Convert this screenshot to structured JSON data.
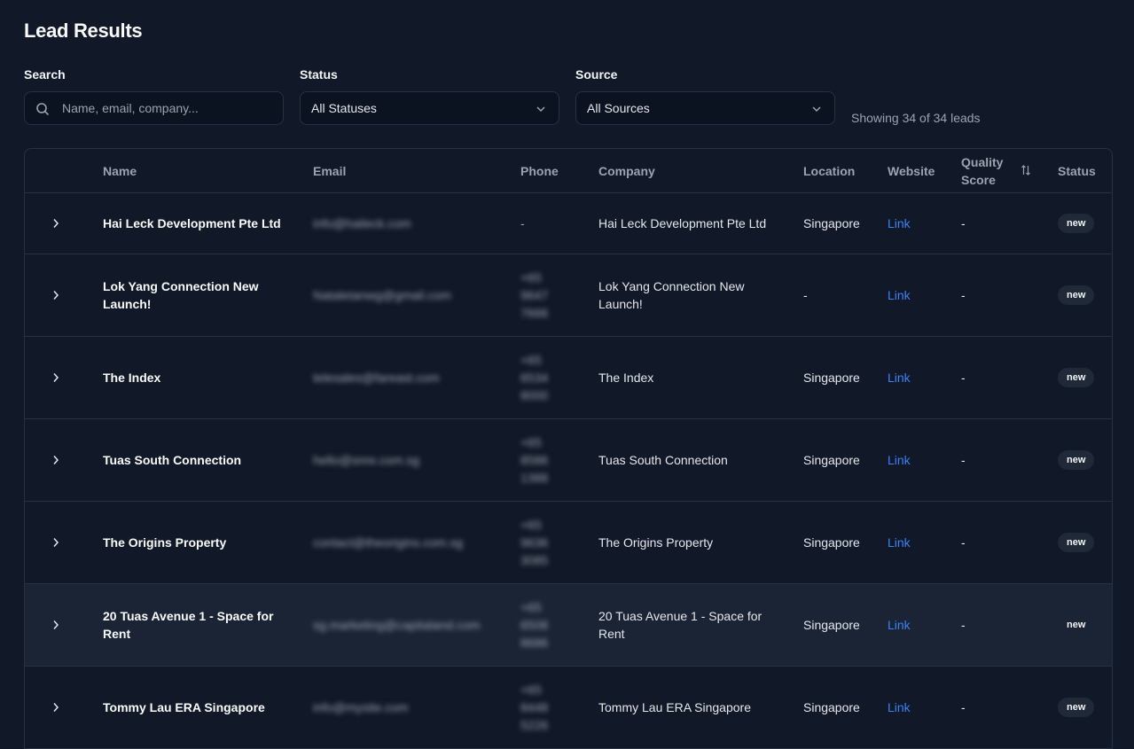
{
  "page": {
    "title": "Lead Results",
    "showing": "Showing 34 of 34 leads"
  },
  "filters": {
    "search": {
      "label": "Search",
      "placeholder": "Name, email, company..."
    },
    "status": {
      "label": "Status",
      "value": "All Statuses"
    },
    "source": {
      "label": "Source",
      "value": "All Sources"
    }
  },
  "table": {
    "headers": {
      "name": "Name",
      "email": "Email",
      "phone": "Phone",
      "company": "Company",
      "location": "Location",
      "website": "Website",
      "quality_line1": "Quality",
      "quality_line2": "Score",
      "status": "Status"
    },
    "rows": [
      {
        "name": "Hai Leck Development Pte Ltd",
        "email": "info@haileck.com",
        "phone": "-",
        "company": "Hai Leck Development Pte Ltd",
        "location": "Singapore",
        "website": "Link",
        "quality": "-",
        "status": "new"
      },
      {
        "name": "Lok Yang Connection New Launch!",
        "email": "Nataletanwg@gmail.com",
        "phone": "+65 9647 7666",
        "company": "Lok Yang Connection New Launch!",
        "location": "-",
        "website": "Link",
        "quality": "-",
        "status": "new"
      },
      {
        "name": "The Index",
        "email": "telesales@fareast.com",
        "phone": "+65 6534 8000",
        "company": "The Index",
        "location": "Singapore",
        "website": "Link",
        "quality": "-",
        "status": "new"
      },
      {
        "name": "Tuas South Connection",
        "email": "hello@snre.com.sg",
        "phone": "+65 8586 1388",
        "company": "Tuas South Connection",
        "location": "Singapore",
        "website": "Link",
        "quality": "-",
        "status": "new"
      },
      {
        "name": "The Origins Property",
        "email": "contact@theorigins.com.sg",
        "phone": "+65 9636 3085",
        "company": "The Origins Property",
        "location": "Singapore",
        "website": "Link",
        "quality": "-",
        "status": "new"
      },
      {
        "name": "20 Tuas Avenue 1 - Space for Rent",
        "email": "sg.marketing@capitaland.com",
        "phone": "+65 6508 8686",
        "company": "20 Tuas Avenue 1 - Space for Rent",
        "location": "Singapore",
        "website": "Link",
        "quality": "-",
        "status": "new"
      },
      {
        "name": "Tommy Lau ERA Singapore",
        "email": "info@mysite.com",
        "phone": "+65 8448 5226",
        "company": "Tommy Lau ERA Singapore",
        "location": "Singapore",
        "website": "Link",
        "quality": "-",
        "status": "new"
      }
    ]
  },
  "icons": {
    "search": "search-icon",
    "chevron": "chevron-down-icon",
    "expand": "chevron-right-icon",
    "sort": "sort-icon"
  },
  "colors": {
    "background": "#111827",
    "link": "#3b82f6",
    "border": "#263244"
  }
}
